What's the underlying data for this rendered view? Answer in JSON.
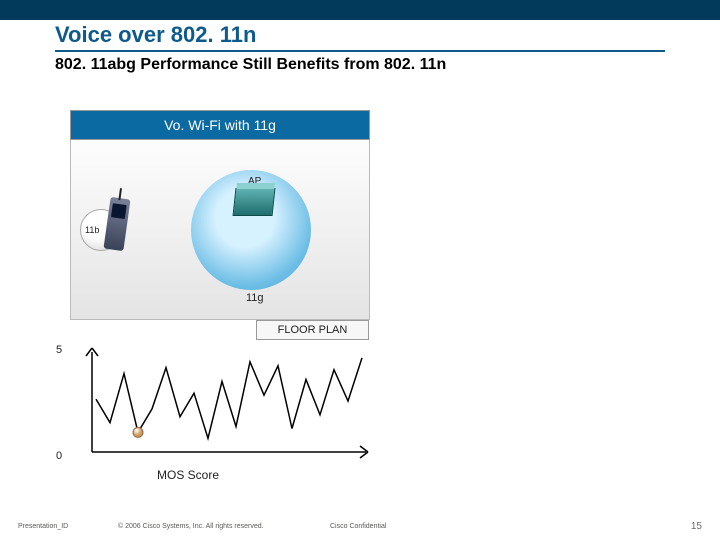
{
  "title": "Voice over 802. 11n",
  "subtitle": "802. 11abg Performance Still Benefits from 802. 11n",
  "panel": {
    "header": "Vo. Wi-Fi with 11g",
    "ap_label": "AP",
    "inner_label": "11g",
    "phone_label": "11b"
  },
  "floorplan_label": "FLOOR PLAN",
  "chart_data": {
    "type": "line",
    "title": "MOS Score",
    "ylabel": "",
    "xlabel": "MOS Score",
    "ylim": [
      0,
      5
    ],
    "y_ticks": [
      "5",
      "0"
    ],
    "x": [
      0,
      1,
      2,
      3,
      4,
      5,
      6,
      7,
      8,
      9,
      10,
      11,
      12,
      13,
      14,
      15,
      16,
      17,
      18,
      19
    ],
    "values": [
      2.7,
      1.5,
      4.0,
      1.0,
      2.2,
      4.3,
      1.8,
      3.0,
      0.7,
      3.6,
      1.3,
      4.6,
      2.9,
      4.4,
      1.2,
      3.7,
      1.9,
      4.2,
      2.6,
      4.8
    ],
    "marker": {
      "index": 3,
      "value": 1.0
    }
  },
  "footer": {
    "id": "Presentation_ID",
    "copyright": "© 2006 Cisco Systems, Inc. All rights reserved.",
    "confidential": "Cisco Confidential",
    "page": "15"
  }
}
